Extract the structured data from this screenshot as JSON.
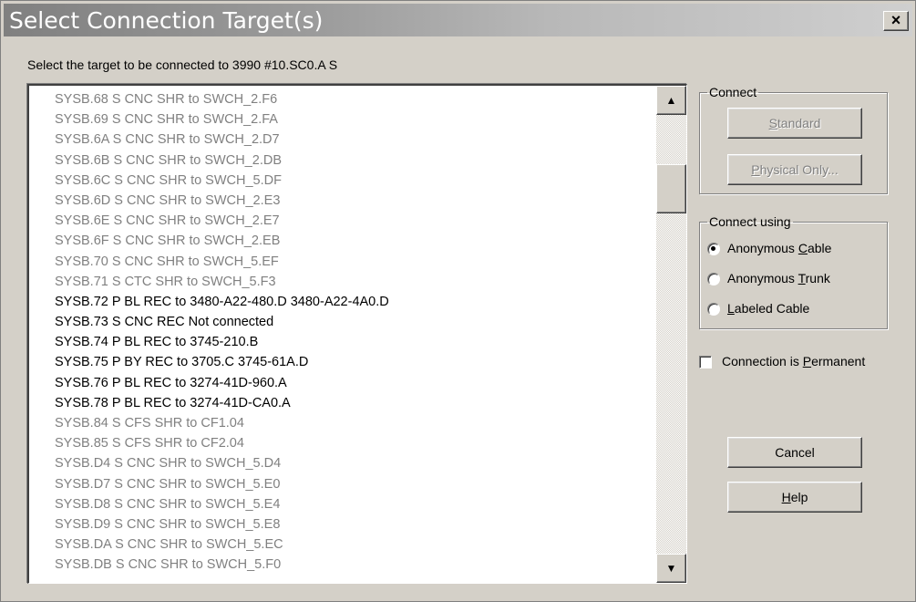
{
  "window": {
    "title": "Select Connection Target(s)",
    "close_glyph": "×"
  },
  "prompt": "Select the target to be connected to 3990 #10.SC0.A S",
  "list": {
    "items": [
      {
        "text": "SYSB.68 S CNC SHR to SWCH_2.F6",
        "enabled": false
      },
      {
        "text": "SYSB.69 S CNC SHR to SWCH_2.FA",
        "enabled": false
      },
      {
        "text": "SYSB.6A S CNC SHR to SWCH_2.D7",
        "enabled": false
      },
      {
        "text": "SYSB.6B S CNC SHR to SWCH_2.DB",
        "enabled": false
      },
      {
        "text": "SYSB.6C S CNC SHR to SWCH_5.DF",
        "enabled": false
      },
      {
        "text": "SYSB.6D S CNC SHR to SWCH_2.E3",
        "enabled": false
      },
      {
        "text": "SYSB.6E S CNC SHR to SWCH_2.E7",
        "enabled": false
      },
      {
        "text": "SYSB.6F S CNC SHR to SWCH_2.EB",
        "enabled": false
      },
      {
        "text": "SYSB.70 S CNC SHR to SWCH_5.EF",
        "enabled": false
      },
      {
        "text": "SYSB.71 S CTC SHR to SWCH_5.F3",
        "enabled": false
      },
      {
        "text": "SYSB.72 P BL REC to 3480-A22-480.D 3480-A22-4A0.D",
        "enabled": true
      },
      {
        "text": "SYSB.73 S CNC REC Not connected",
        "enabled": true
      },
      {
        "text": "SYSB.74 P BL REC to 3745-210.B",
        "enabled": true
      },
      {
        "text": "SYSB.75 P BY REC to 3705.C 3745-61A.D",
        "enabled": true
      },
      {
        "text": "SYSB.76 P BL REC to 3274-41D-960.A",
        "enabled": true
      },
      {
        "text": "SYSB.78 P BL REC to 3274-41D-CA0.A",
        "enabled": true
      },
      {
        "text": "SYSB.84 S CFS SHR to CF1.04",
        "enabled": false
      },
      {
        "text": "SYSB.85 S CFS SHR to CF2.04",
        "enabled": false
      },
      {
        "text": "SYSB.D4 S CNC SHR to SWCH_5.D4",
        "enabled": false
      },
      {
        "text": "SYSB.D7 S CNC SHR to SWCH_5.E0",
        "enabled": false
      },
      {
        "text": "SYSB.D8 S CNC SHR to SWCH_5.E4",
        "enabled": false
      },
      {
        "text": "SYSB.D9 S CNC SHR to SWCH_5.E8",
        "enabled": false
      },
      {
        "text": "SYSB.DA S CNC SHR to SWCH_5.EC",
        "enabled": false
      },
      {
        "text": "SYSB.DB S CNC SHR to SWCH_5.F0",
        "enabled": false
      }
    ],
    "scroll_up_glyph": "▲",
    "scroll_down_glyph": "▼"
  },
  "connect_group": {
    "legend": "Connect",
    "standard": {
      "pre": "",
      "key": "S",
      "post": "tandard",
      "enabled": false
    },
    "physical": {
      "pre": "",
      "key": "P",
      "post": "hysical Only...",
      "enabled": false
    }
  },
  "connect_using_group": {
    "legend": "Connect using",
    "options": [
      {
        "pre": "Anonymous ",
        "key": "C",
        "post": "able",
        "selected": true
      },
      {
        "pre": "Anonymous ",
        "key": "T",
        "post": "runk",
        "selected": false
      },
      {
        "pre": "",
        "key": "L",
        "post": "abeled Cable",
        "selected": false
      }
    ]
  },
  "permanent": {
    "pre": "Connection is ",
    "key": "P",
    "post": "ermanent",
    "checked": false
  },
  "cancel": {
    "label": "Cancel"
  },
  "help": {
    "pre": "",
    "key": "H",
    "post": "elp"
  }
}
